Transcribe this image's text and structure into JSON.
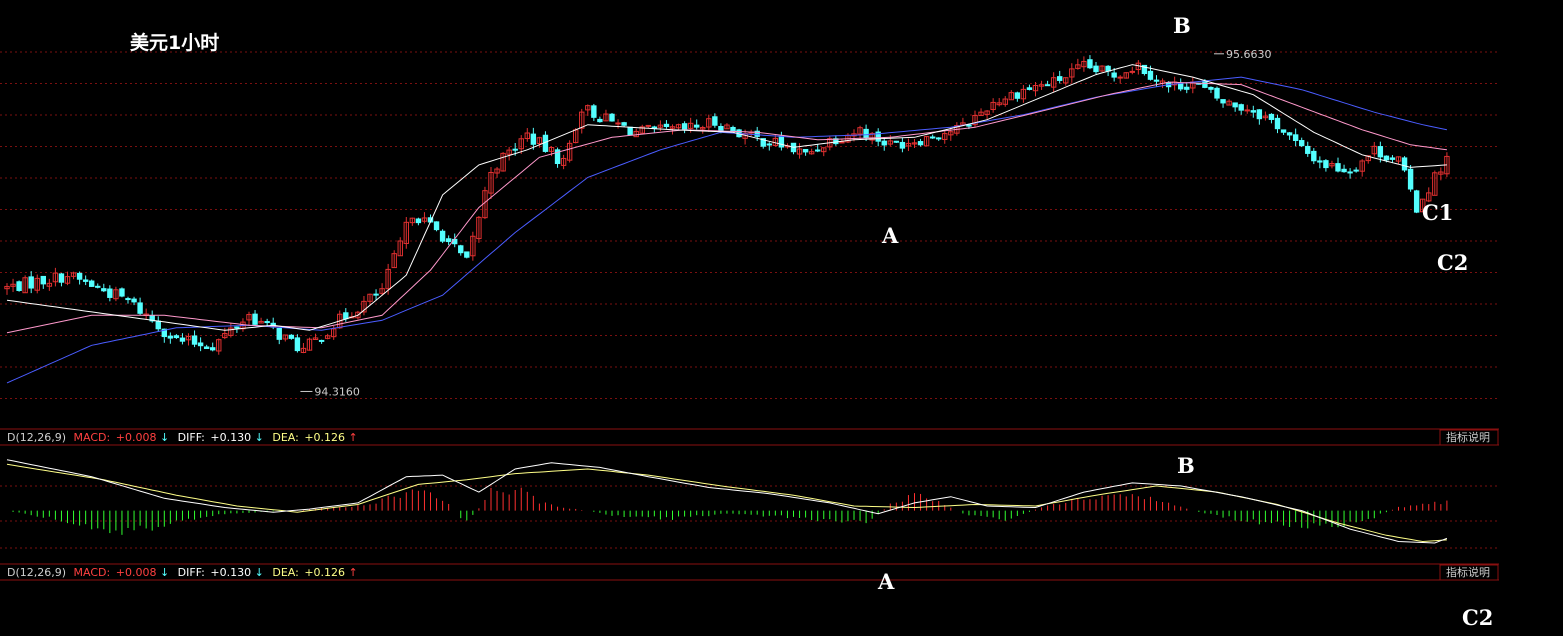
{
  "title": "美元1小时",
  "indicator": {
    "prefix": "D(12,26,9)",
    "macd_label": "MACD:",
    "macd_value": "+0.008",
    "macd_arrow": "↓",
    "diff_label": "DIFF:",
    "diff_value": "+0.130",
    "diff_arrow": "↓",
    "dea_label": "DEA:",
    "dea_value": "+0.126",
    "dea_arrow": "↑",
    "help_button": "指标说明"
  },
  "annotations": {
    "high_price": "95.6630",
    "low_price": "94.3160",
    "price_A": "A",
    "price_B": "B",
    "price_C1": "C1",
    "price_C2": "C2",
    "macd_A": "A",
    "macd_B": "B",
    "macd_C2": "C2"
  },
  "colors": {
    "background": "#000000",
    "up_candle": "#e03030",
    "down_candle": "#54ffff",
    "ma_short": "#ffffff",
    "ma_mid": "#ff99cc",
    "ma_long": "#4a5cff",
    "grid": "#7a1010",
    "macd_pos": "#ff3030",
    "macd_neg": "#30ff30",
    "diff_line": "#ffffff",
    "dea_line": "#ffff88"
  },
  "chart_data": [
    {
      "type": "candlestick",
      "title": "美元1小时",
      "ylim": [
        94.25,
        95.75
      ],
      "grid": true,
      "close_path": [
        [
          0,
          94.73
        ],
        [
          10,
          94.78
        ],
        [
          20,
          94.68
        ],
        [
          28,
          94.52
        ],
        [
          34,
          94.5
        ],
        [
          40,
          94.62
        ],
        [
          44,
          94.56
        ],
        [
          49,
          94.48
        ],
        [
          55,
          94.6
        ],
        [
          62,
          94.72
        ],
        [
          67,
          95.03
        ],
        [
          72,
          94.94
        ],
        [
          76,
          94.83
        ],
        [
          80,
          95.2
        ],
        [
          86,
          95.34
        ],
        [
          92,
          95.23
        ],
        [
          95,
          95.45
        ],
        [
          99,
          95.4
        ],
        [
          104,
          95.35
        ],
        [
          112,
          95.36
        ],
        [
          117,
          95.39
        ],
        [
          123,
          95.33
        ],
        [
          128,
          95.3
        ],
        [
          132,
          95.26
        ],
        [
          136,
          95.32
        ],
        [
          141,
          95.36
        ],
        [
          146,
          95.3
        ],
        [
          152,
          95.33
        ],
        [
          158,
          95.37
        ],
        [
          163,
          95.47
        ],
        [
          168,
          95.52
        ],
        [
          173,
          95.55
        ],
        [
          178,
          95.61
        ],
        [
          183,
          95.58
        ],
        [
          187,
          95.62
        ],
        [
          192,
          95.53
        ],
        [
          196,
          95.55
        ],
        [
          201,
          95.47
        ],
        [
          206,
          95.44
        ],
        [
          210,
          95.38
        ],
        [
          214,
          95.28
        ],
        [
          218,
          95.22
        ],
        [
          222,
          95.2
        ],
        [
          226,
          95.28
        ],
        [
          230,
          95.24
        ],
        [
          233,
          95.05
        ],
        [
          235,
          95.13
        ],
        [
          238,
          95.25
        ]
      ],
      "ma_short_path": [
        [
          0,
          94.68
        ],
        [
          12,
          94.64
        ],
        [
          24,
          94.6
        ],
        [
          36,
          94.56
        ],
        [
          44,
          94.58
        ],
        [
          50,
          94.56
        ],
        [
          58,
          94.62
        ],
        [
          66,
          94.78
        ],
        [
          72,
          95.1
        ],
        [
          78,
          95.22
        ],
        [
          86,
          95.28
        ],
        [
          96,
          95.38
        ],
        [
          110,
          95.36
        ],
        [
          120,
          95.35
        ],
        [
          130,
          95.29
        ],
        [
          140,
          95.32
        ],
        [
          150,
          95.33
        ],
        [
          162,
          95.4
        ],
        [
          172,
          95.5
        ],
        [
          180,
          95.58
        ],
        [
          186,
          95.62
        ],
        [
          196,
          95.57
        ],
        [
          206,
          95.5
        ],
        [
          216,
          95.35
        ],
        [
          224,
          95.26
        ],
        [
          232,
          95.21
        ],
        [
          238,
          95.22
        ]
      ],
      "ma_mid_path": [
        [
          0,
          94.55
        ],
        [
          14,
          94.62
        ],
        [
          26,
          94.62
        ],
        [
          40,
          94.58
        ],
        [
          52,
          94.57
        ],
        [
          62,
          94.62
        ],
        [
          70,
          94.8
        ],
        [
          78,
          95.05
        ],
        [
          88,
          95.25
        ],
        [
          100,
          95.33
        ],
        [
          112,
          95.36
        ],
        [
          124,
          95.35
        ],
        [
          134,
          95.32
        ],
        [
          146,
          95.33
        ],
        [
          160,
          95.37
        ],
        [
          172,
          95.44
        ],
        [
          182,
          95.5
        ],
        [
          192,
          95.55
        ],
        [
          204,
          95.54
        ],
        [
          214,
          95.45
        ],
        [
          224,
          95.36
        ],
        [
          232,
          95.3
        ],
        [
          238,
          95.28
        ]
      ],
      "ma_long_path": [
        [
          0,
          94.35
        ],
        [
          14,
          94.5
        ],
        [
          28,
          94.57
        ],
        [
          40,
          94.58
        ],
        [
          52,
          94.56
        ],
        [
          62,
          94.6
        ],
        [
          72,
          94.7
        ],
        [
          84,
          94.95
        ],
        [
          96,
          95.17
        ],
        [
          108,
          95.28
        ],
        [
          118,
          95.35
        ],
        [
          130,
          95.33
        ],
        [
          142,
          95.34
        ],
        [
          156,
          95.37
        ],
        [
          168,
          95.42
        ],
        [
          180,
          95.49
        ],
        [
          192,
          95.54
        ],
        [
          204,
          95.57
        ],
        [
          214,
          95.52
        ],
        [
          226,
          95.43
        ],
        [
          234,
          95.38
        ],
        [
          238,
          95.36
        ]
      ],
      "high": 95.663,
      "low": 94.316
    },
    {
      "type": "macd",
      "fast": 12,
      "slow": 26,
      "signal": 9,
      "macd": 0.008,
      "diff": 0.13,
      "dea": 0.126,
      "ylim": [
        -0.32,
        0.38
      ],
      "diff_path": [
        [
          0,
          0.33
        ],
        [
          14,
          0.22
        ],
        [
          26,
          0.08
        ],
        [
          36,
          0.02
        ],
        [
          44,
          -0.01
        ],
        [
          50,
          0.01
        ],
        [
          58,
          0.05
        ],
        [
          66,
          0.22
        ],
        [
          72,
          0.23
        ],
        [
          78,
          0.12
        ],
        [
          84,
          0.27
        ],
        [
          90,
          0.31
        ],
        [
          98,
          0.28
        ],
        [
          106,
          0.22
        ],
        [
          116,
          0.15
        ],
        [
          126,
          0.11
        ],
        [
          136,
          0.05
        ],
        [
          144,
          -0.02
        ],
        [
          150,
          0.05
        ],
        [
          156,
          0.09
        ],
        [
          162,
          0.03
        ],
        [
          170,
          0.02
        ],
        [
          178,
          0.12
        ],
        [
          186,
          0.18
        ],
        [
          194,
          0.16
        ],
        [
          204,
          0.09
        ],
        [
          214,
          0.0
        ],
        [
          222,
          -0.12
        ],
        [
          230,
          -0.2
        ],
        [
          236,
          -0.21
        ],
        [
          238,
          -0.18
        ]
      ],
      "dea_path": [
        [
          0,
          0.3
        ],
        [
          16,
          0.2
        ],
        [
          28,
          0.1
        ],
        [
          38,
          0.03
        ],
        [
          48,
          -0.01
        ],
        [
          58,
          0.04
        ],
        [
          68,
          0.17
        ],
        [
          76,
          0.2
        ],
        [
          84,
          0.24
        ],
        [
          96,
          0.27
        ],
        [
          106,
          0.23
        ],
        [
          118,
          0.16
        ],
        [
          130,
          0.1
        ],
        [
          140,
          0.03
        ],
        [
          150,
          0.02
        ],
        [
          160,
          0.04
        ],
        [
          170,
          0.03
        ],
        [
          180,
          0.1
        ],
        [
          190,
          0.16
        ],
        [
          200,
          0.12
        ],
        [
          210,
          0.04
        ],
        [
          220,
          -0.08
        ],
        [
          228,
          -0.16
        ],
        [
          234,
          -0.2
        ],
        [
          238,
          -0.19
        ]
      ],
      "hist_path": [
        [
          0,
          0.0
        ],
        [
          6,
          -0.04
        ],
        [
          14,
          -0.1
        ],
        [
          20,
          -0.14
        ],
        [
          28,
          -0.07
        ],
        [
          36,
          -0.02
        ],
        [
          42,
          -0.01
        ],
        [
          50,
          0.01
        ],
        [
          58,
          0.03
        ],
        [
          64,
          0.09
        ],
        [
          68,
          0.15
        ],
        [
          72,
          0.08
        ],
        [
          76,
          -0.08
        ],
        [
          80,
          0.12
        ],
        [
          84,
          0.14
        ],
        [
          88,
          0.06
        ],
        [
          92,
          0.02
        ],
        [
          96,
          0.0
        ],
        [
          100,
          -0.03
        ],
        [
          110,
          -0.05
        ],
        [
          120,
          -0.02
        ],
        [
          128,
          -0.04
        ],
        [
          136,
          -0.06
        ],
        [
          142,
          -0.08
        ],
        [
          146,
          0.04
        ],
        [
          150,
          0.11
        ],
        [
          154,
          0.06
        ],
        [
          158,
          -0.02
        ],
        [
          166,
          -0.06
        ],
        [
          172,
          0.04
        ],
        [
          178,
          0.08
        ],
        [
          184,
          0.11
        ],
        [
          190,
          0.07
        ],
        [
          196,
          0.0
        ],
        [
          204,
          -0.06
        ],
        [
          212,
          -0.09
        ],
        [
          218,
          -0.11
        ],
        [
          224,
          -0.07
        ],
        [
          230,
          0.02
        ],
        [
          234,
          0.04
        ],
        [
          238,
          0.06
        ]
      ]
    }
  ]
}
